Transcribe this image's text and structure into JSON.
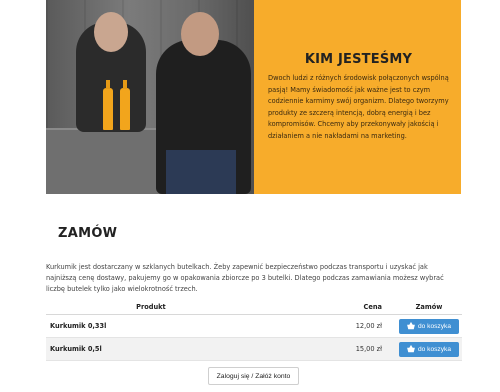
{
  "about": {
    "title": "KIM JESTEŚMY",
    "text": "Dwoch ludzi z różnych środowisk połączonych wspólną pasją! Mamy świadomość jak ważne jest to czym codziennie karmimy swój organizm. Dlatego tworzymy produkty ze szczerą intencją, dobrą energią i bez kompromisów. Chcemy aby przekonywały jakością i działaniem a nie nakładami na marketing."
  },
  "order": {
    "title": "ZAMÓW",
    "description": "Kurkumik jest dostarczany w szklanych butelkach. Żeby zapewnić bezpieczeństwo podczas transportu i uzyskać jak najniższą cenę dostawy, pakujemy go w opakowania zbiorcze po 3 butelki. Dlatego podczas zamawiania możesz wybrać liczbę butelek tylko jako wielokrotność trzech.",
    "table": {
      "headers": [
        "Produkt",
        "Cena",
        "Zamów"
      ],
      "rows": [
        {
          "product": "Kurkumik 0,33l",
          "price": "12,00 zł",
          "button": "do koszyka"
        },
        {
          "product": "Kurkumik 0,5l",
          "price": "15,00 zł",
          "button": "do koszyka"
        }
      ]
    },
    "login_button": "Zaloguj się / Załóż konto"
  },
  "icons": {
    "cart": "basket-icon"
  },
  "colors": {
    "accent": "#f7ac2b",
    "button": "#3f8fd2"
  }
}
